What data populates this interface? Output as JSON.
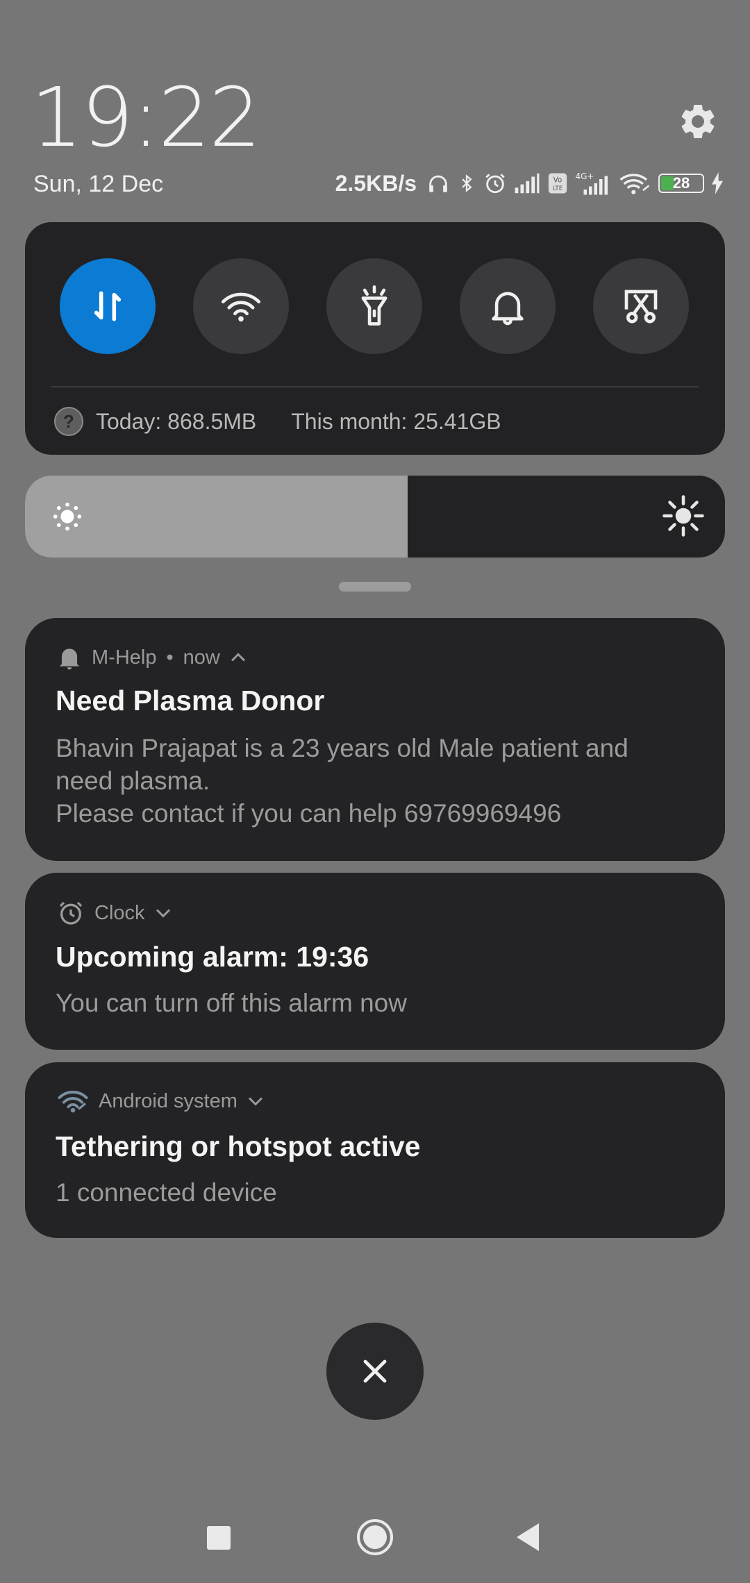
{
  "status": {
    "time": "19:22",
    "date": "Sun, 12 Dec",
    "net_speed": "2.5KB/s",
    "network_4g": "4G+",
    "volte": "Vo LTE",
    "battery_level": "28"
  },
  "quick_settings": {
    "toggles": [
      {
        "name": "mobile-data",
        "active": true
      },
      {
        "name": "wifi",
        "active": false
      },
      {
        "name": "flashlight",
        "active": false
      },
      {
        "name": "sound",
        "active": false
      },
      {
        "name": "screenshot",
        "active": false
      }
    ],
    "data_usage": {
      "today": "Today: 868.5MB",
      "month": "This month: 25.41GB"
    },
    "brightness_fraction": 0.547
  },
  "notifications": [
    {
      "app": "M-Help",
      "time": "now",
      "title": "Need Plasma Donor",
      "body": "Bhavin Prajapat is a 23 years old Male patient and need plasma.\nPlease contact if you can help 69769969496"
    },
    {
      "app": "Clock",
      "title": "Upcoming alarm: 19:36",
      "body": "You can turn off this alarm now"
    },
    {
      "app": "Android system",
      "title": "Tethering or hotspot active",
      "body": "1 connected device"
    }
  ],
  "colors": {
    "accent": "#0b7bd4",
    "background": "#767676",
    "panel": "#222224"
  }
}
